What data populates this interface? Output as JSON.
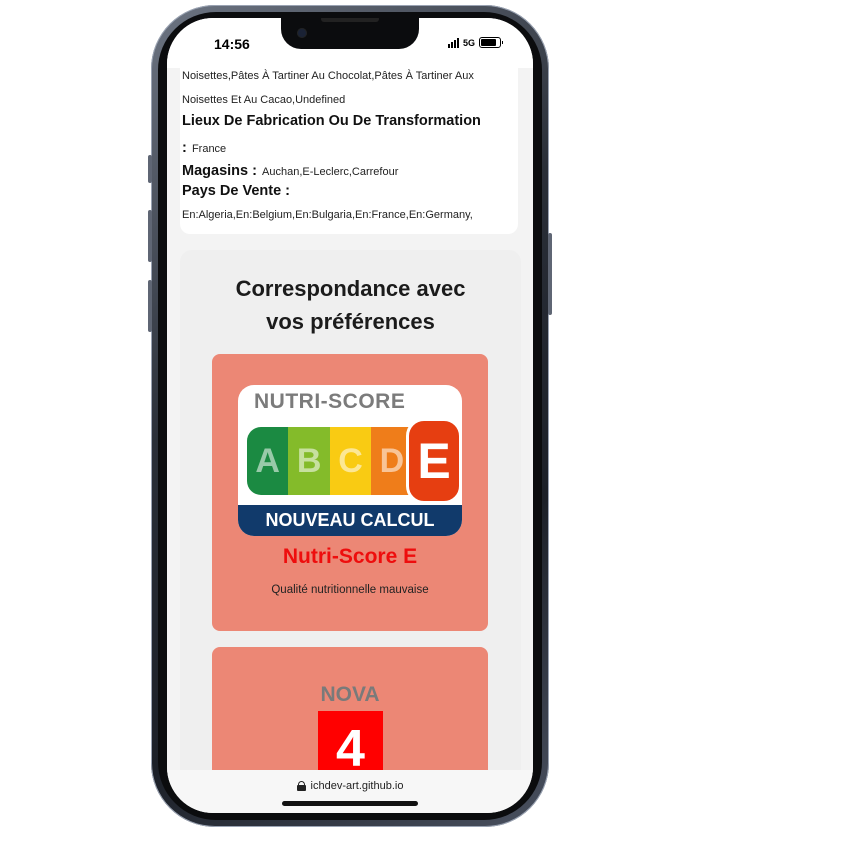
{
  "status_bar": {
    "time": "14:56",
    "network": "5G"
  },
  "product_info": {
    "line1": "Noisettes,Pâtes À Tartiner Au Chocolat,Pâtes À Tartiner Aux",
    "line2": "Noisettes Et Au Cacao,Undefined",
    "manufacturing_heading": "Lieux De Fabrication Ou De Transformation",
    "manufacturing_colon": ":",
    "manufacturing_value": "France",
    "stores_heading": "Magasins :",
    "stores_value": "Auchan,E-Leclerc,Carrefour",
    "countries_heading": "Pays De Vente :",
    "countries_value": "En:Algeria,En:Belgium,En:Bulgaria,En:France,En:Germany,"
  },
  "preferences": {
    "title_line1": "Correspondance avec",
    "title_line2": "vos préférences",
    "nutriscore": {
      "logo_header": "NUTRI-SCORE",
      "letters": [
        "A",
        "B",
        "C",
        "D"
      ],
      "active_letter": "E",
      "logo_footer": "NOUVEAU CALCUL",
      "grade": "Nutri-Score E",
      "description": "Qualité nutritionnelle mauvaise"
    },
    "nova": {
      "label": "NOVA",
      "value": "4"
    }
  },
  "url_bar": {
    "url": "ichdev-art.github.io"
  }
}
